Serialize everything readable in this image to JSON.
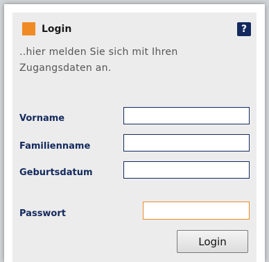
{
  "login_box": {
    "title": "Login",
    "help_label": "?",
    "intro_line1": "..hier melden Sie sich mit Ihren",
    "intro_line2": "Zugangsdaten an.",
    "fields": {
      "vorname": {
        "label": "Vorname",
        "value": ""
      },
      "familienname": {
        "label": "Familienname",
        "value": ""
      },
      "geburtsdatum": {
        "label": "Geburtsdatum",
        "value": ""
      },
      "passwort": {
        "label": "Passwort",
        "value": ""
      }
    },
    "submit_label": "Login",
    "colors": {
      "accent": "#f08a24",
      "label": "#13295d",
      "panel": "#ececec"
    },
    "icons": {
      "header": "orange-square-icon",
      "help": "help-icon"
    }
  }
}
